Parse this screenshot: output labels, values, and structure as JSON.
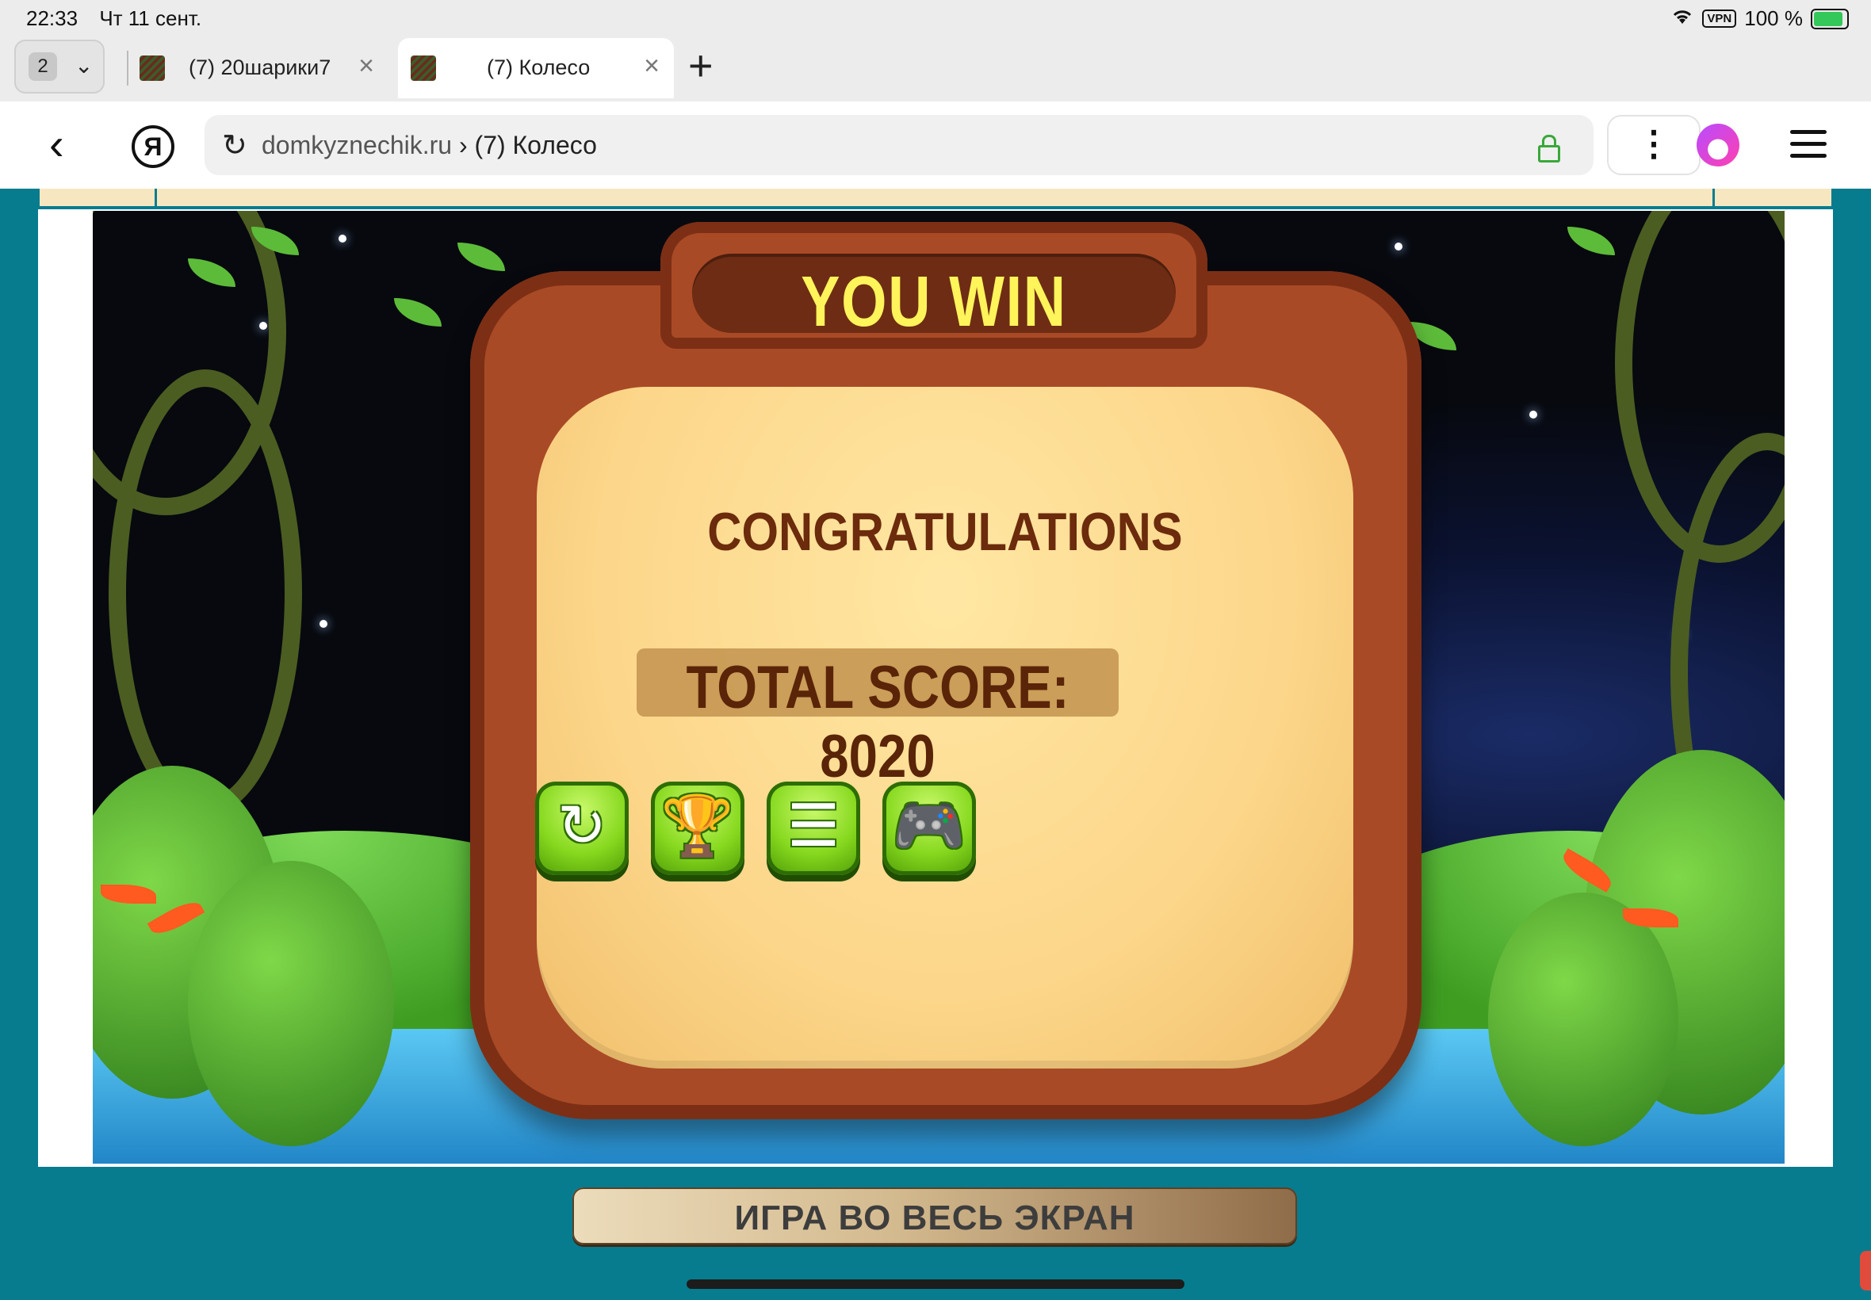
{
  "status": {
    "time": "22:33",
    "date": "Чт 11 сент.",
    "vpn": "VPN",
    "battery": "100 %"
  },
  "tabs": {
    "count": "2",
    "items": [
      {
        "title": "(7) 20шарики7"
      },
      {
        "title": "(7) Колесо"
      }
    ]
  },
  "address": {
    "host": "domkyznechik.ru",
    "separator": "›",
    "page": "(7) Колесо"
  },
  "game": {
    "banner": "YOU WIN",
    "heading": "CONGRATULATIONS",
    "score_label": "TOTAL SCORE: 8020",
    "score": 8020,
    "buttons": [
      {
        "icon": "restart-icon"
      },
      {
        "icon": "trophy-icon"
      },
      {
        "icon": "list-icon"
      },
      {
        "icon": "gamepad-icon"
      }
    ]
  },
  "fullscreen_button": "ИГРА ВО ВЕСЬ ЭКРАН",
  "colors": {
    "page_bg": "#077c8f",
    "banner_text": "#fff45a",
    "button_green": "#86d81e"
  }
}
